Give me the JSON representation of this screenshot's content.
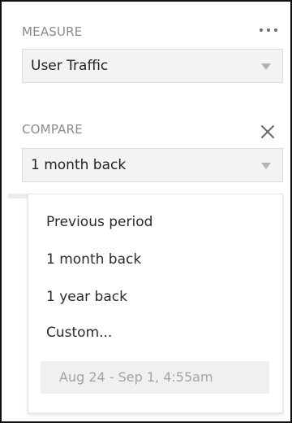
{
  "measure": {
    "label": "MEASURE",
    "value": "User Traffic"
  },
  "compare": {
    "label": "COMPARE",
    "value": "1 month back"
  },
  "dropdown": {
    "options": [
      "Previous period",
      "1 month back",
      "1 year back",
      "Custom..."
    ],
    "date_range": "Aug 24 - Sep 1, 4:55am"
  },
  "icons": {
    "more": "more-horizontal-icon",
    "close": "close-icon",
    "caret": "caret-down-icon"
  },
  "colors": {
    "label_gray": "#8a8a8a",
    "select_bg": "#f3f3f3",
    "text": "#222222"
  }
}
